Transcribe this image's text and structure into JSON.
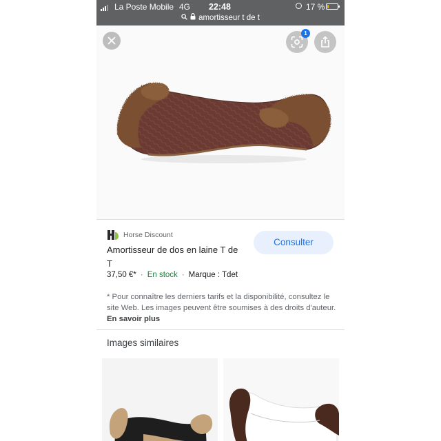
{
  "status_bar": {
    "carrier": "La Poste Mobile",
    "network": "4G",
    "time": "22:48",
    "battery_percent": "17 %",
    "battery_level": 0.17,
    "url": "amortisseur t de t"
  },
  "product": {
    "source_name": "Horse Discount",
    "title": "Amortisseur de dos en laine T de T",
    "price": "37,50 €*",
    "availability": "En stock",
    "brand": "Marque : Tdet",
    "consult_label": "Consulter"
  },
  "notice": {
    "text": "* Pour connaître les derniers tarifs et la disponibilité, consultez le site Web. Les images peuvent être soumises à des droits d'auteur.",
    "link": "En savoir plus"
  },
  "similar": {
    "title": "Images similaires"
  },
  "icons": {
    "close": "close-icon",
    "lens": "lens-icon",
    "share": "share-icon",
    "signal": "signal-icon",
    "lock": "lock-icon",
    "search": "search-icon",
    "orientation_lock": "orientation-lock-icon",
    "battery": "battery-icon"
  },
  "colors": {
    "status_bar": "#5f6163",
    "accent": "#1a73e8",
    "stock_green": "#188038",
    "button_bg": "#e8f0fe"
  }
}
